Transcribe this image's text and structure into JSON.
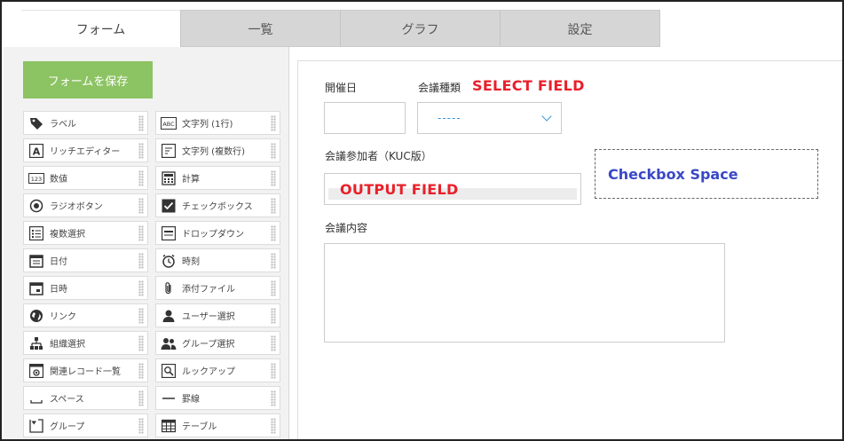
{
  "tabs": [
    {
      "label": "フォーム",
      "active": true
    },
    {
      "label": "一覧",
      "active": false
    },
    {
      "label": "グラフ",
      "active": false
    },
    {
      "label": "設定",
      "active": false
    }
  ],
  "save_button": "フォームを保存",
  "palette": [
    [
      {
        "label": "ラベル",
        "icon": "tag-icon"
      },
      {
        "label": "文字列 (1行)",
        "icon": "abc-icon"
      }
    ],
    [
      {
        "label": "リッチエディター",
        "icon": "rich-editor-icon"
      },
      {
        "label": "文字列 (複数行)",
        "icon": "multiline-text-icon"
      }
    ],
    [
      {
        "label": "数値",
        "icon": "number-icon"
      },
      {
        "label": "計算",
        "icon": "calculator-icon"
      }
    ],
    [
      {
        "label": "ラジオボタン",
        "icon": "radio-icon"
      },
      {
        "label": "チェックボックス",
        "icon": "checkbox-icon"
      }
    ],
    [
      {
        "label": "複数選択",
        "icon": "multi-select-icon"
      },
      {
        "label": "ドロップダウン",
        "icon": "dropdown-icon"
      }
    ],
    [
      {
        "label": "日付",
        "icon": "calendar-icon"
      },
      {
        "label": "時刻",
        "icon": "clock-icon"
      }
    ],
    [
      {
        "label": "日時",
        "icon": "datetime-icon"
      },
      {
        "label": "添付ファイル",
        "icon": "paperclip-icon"
      }
    ],
    [
      {
        "label": "リンク",
        "icon": "globe-icon"
      },
      {
        "label": "ユーザー選択",
        "icon": "user-icon"
      }
    ],
    [
      {
        "label": "組織選択",
        "icon": "org-icon"
      },
      {
        "label": "グループ選択",
        "icon": "group-icon"
      }
    ],
    [
      {
        "label": "関連レコード一覧",
        "icon": "related-records-icon"
      },
      {
        "label": "ルックアップ",
        "icon": "lookup-icon"
      }
    ],
    [
      {
        "label": "スペース",
        "icon": "space-icon"
      },
      {
        "label": "罫線",
        "icon": "line-icon"
      }
    ],
    [
      {
        "label": "グループ",
        "icon": "group-field-icon"
      },
      {
        "label": "テーブル",
        "icon": "table-icon"
      }
    ]
  ],
  "form": {
    "date_label": "開催日",
    "type_label": "会議種類",
    "select_field_text": "SELECT FIELD",
    "select_value": "-----",
    "participants_label": "会議参加者（KUC版）",
    "output_field_text": "OUTPUT FIELD",
    "checkbox_space_text": "Checkbox Space",
    "content_label": "会議内容"
  }
}
